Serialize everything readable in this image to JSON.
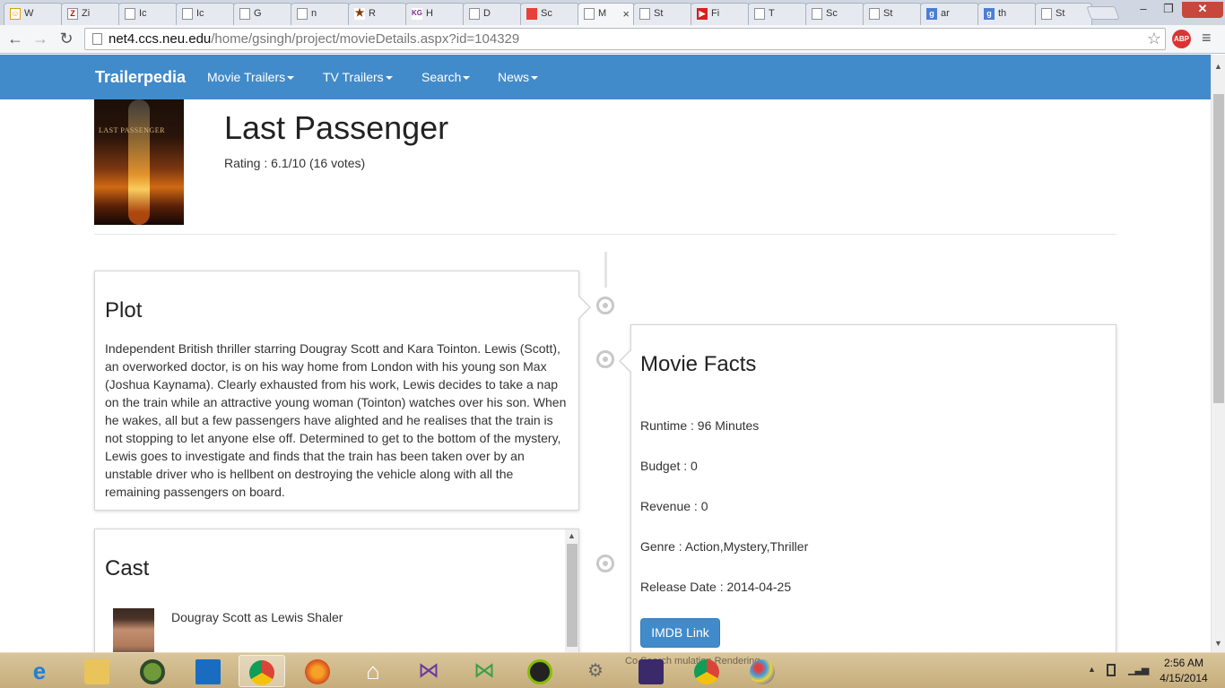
{
  "browser": {
    "tabs": [
      {
        "label": "W",
        "icon": "user-icon"
      },
      {
        "label": "Zi",
        "icon": "zotero-icon"
      },
      {
        "label": "Ic",
        "icon": "page-icon"
      },
      {
        "label": "Ic",
        "icon": "page-icon"
      },
      {
        "label": "G",
        "icon": "page-icon"
      },
      {
        "label": "n",
        "icon": "page-icon"
      },
      {
        "label": "R",
        "icon": "star-icon"
      },
      {
        "label": "H",
        "icon": "kg-icon"
      },
      {
        "label": "D",
        "icon": "page-icon"
      },
      {
        "label": "Sc",
        "icon": "scribd-icon"
      },
      {
        "label": "M",
        "icon": "page-icon",
        "active": true
      },
      {
        "label": "St",
        "icon": "page-icon"
      },
      {
        "label": "Fi",
        "icon": "youtube-icon"
      },
      {
        "label": "T",
        "icon": "page-icon"
      },
      {
        "label": "Sc",
        "icon": "page-icon"
      },
      {
        "label": "St",
        "icon": "page-icon"
      },
      {
        "label": "ar",
        "icon": "google-icon"
      },
      {
        "label": "th",
        "icon": "google-icon"
      },
      {
        "label": "St",
        "icon": "page-icon"
      }
    ],
    "tab_close": "×",
    "url_host": "net4.ccs.neu.edu",
    "url_path": "/home/gsingh/project/movieDetails.aspx?id=104329",
    "abp_label": "ABP"
  },
  "site": {
    "brand": "Trailerpedia",
    "nav": [
      "Movie Trailers",
      "TV Trailers",
      "Search",
      "News"
    ]
  },
  "movie": {
    "poster_text": "LAST PASSENGER",
    "title": "Last Passenger",
    "rating": "Rating : 6.1/10 (16 votes)",
    "plot_heading": "Plot",
    "plot": "Independent British thriller starring Dougray Scott and Kara Tointon. Lewis (Scott), an overworked doctor, is on his way home from London with his young son Max (Joshua Kaynama). Clearly exhausted from his work, Lewis decides to take a nap on the train while an attractive young woman (Tointon) watches over his son. When he wakes, all but a few passengers have alighted and he realises that the train is not stopping to let anyone else off. Determined to get to the bottom of the mystery, Lewis goes to investigate and finds that the train has been taken over by an unstable driver who is hellbent on destroying the vehicle along with all the remaining passengers on board.",
    "cast_heading": "Cast",
    "cast": [
      {
        "line": "Dougray Scott as Lewis Shaler"
      }
    ],
    "facts_heading": "Movie Facts",
    "facts": {
      "runtime": "Runtime : 96 Minutes",
      "budget": "Budget : 0",
      "revenue": "Revenue : 0",
      "genre": "Genre : Action,Mystery,Thriller",
      "release": "Release Date : 2014-04-25"
    },
    "imdb_label": "IMDB Link"
  },
  "taskbar": {
    "apps": [
      "internet-explorer-icon",
      "file-explorer-icon",
      "app-ring-icon",
      "lenovo-icon",
      "chrome-icon",
      "firefox-icon",
      "home-icon",
      "visual-studio-icon",
      "visual-studio-green-icon",
      "spotify-icon",
      "tool-icon",
      "java-ee-ide-icon",
      "chrome-icon",
      "paint-icon"
    ],
    "overlay_text": "Co      Search  mulation   Rendering",
    "time": "2:56 AM",
    "date": "4/15/2014"
  },
  "colors": {
    "navbar": "#428bca",
    "button": "#428bca",
    "taskbar": "#c6ad7c"
  }
}
